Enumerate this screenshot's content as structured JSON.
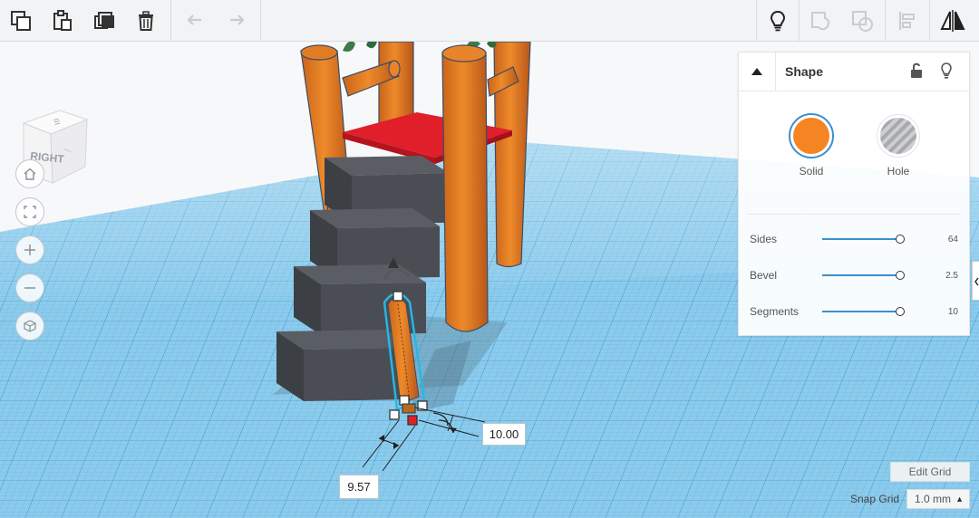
{
  "toolbar": {
    "left": [
      {
        "name": "copy-icon"
      },
      {
        "name": "paste-icon"
      },
      {
        "name": "duplicate-icon"
      },
      {
        "name": "delete-icon"
      }
    ],
    "history": [
      {
        "name": "undo-icon"
      },
      {
        "name": "redo-icon"
      }
    ],
    "right": [
      {
        "name": "lightbulb-icon"
      },
      {
        "name": "group-icon"
      },
      {
        "name": "ungroup-icon"
      },
      {
        "name": "align-icon"
      },
      {
        "name": "mirror-icon"
      }
    ]
  },
  "view_cube": {
    "face_label": "RIGHT"
  },
  "nav": [
    {
      "name": "home-icon"
    },
    {
      "name": "fit-view-icon"
    },
    {
      "name": "zoom-in-icon"
    },
    {
      "name": "zoom-out-icon"
    },
    {
      "name": "ortho-view-icon"
    }
  ],
  "inspector": {
    "title": "Shape",
    "solid_label": "Solid",
    "hole_label": "Hole",
    "solid_color": "#f58422",
    "properties": [
      {
        "label": "Sides",
        "value": "64",
        "fraction": 1.0
      },
      {
        "label": "Bevel",
        "value": "2.5",
        "fraction": 1.0
      },
      {
        "label": "Segments",
        "value": "10",
        "fraction": 1.0
      }
    ]
  },
  "dimensions": {
    "length": "10.00",
    "width": "9.57"
  },
  "grid": {
    "edit_label": "Edit Grid",
    "snap_label": "Snap Grid",
    "snap_value": "1.0 mm"
  },
  "colors": {
    "grid": "#7fc2e6",
    "stairs": "#4a4e54",
    "platform": "#e01f2b",
    "pillar": "#e27a1f",
    "selection": "#25b8e6"
  }
}
